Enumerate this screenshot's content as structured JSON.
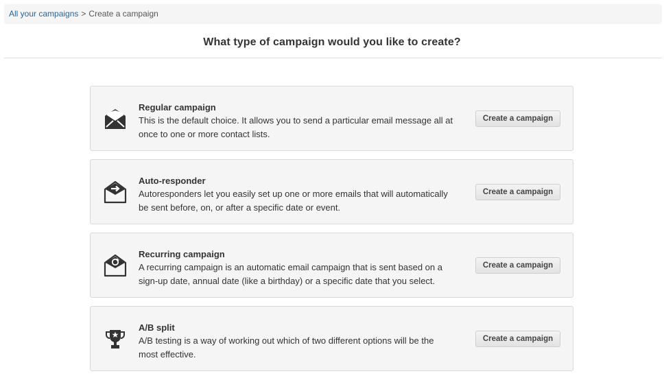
{
  "breadcrumb": {
    "root": "All your campaigns",
    "separator": ">",
    "current": "Create a campaign"
  },
  "title": "What type of campaign would you like to create?",
  "campaigns": [
    {
      "name": "Regular campaign",
      "description": "This is the default choice. It allows you to send a particular email message all at once to one or more contact lists.",
      "button": "Create a campaign",
      "icon": "open-envelope-icon"
    },
    {
      "name": "Auto-responder",
      "description": "Autoresponders let you easily set up one or more emails that will automatically be sent before, on, or after a specific date or event.",
      "button": "Create a campaign",
      "icon": "envelope-arrow-icon"
    },
    {
      "name": "Recurring campaign",
      "description": "A recurring campaign is an automatic email campaign that is sent based on a sign-up date, annual date (like a birthday) or a specific date that you select.",
      "button": "Create a campaign",
      "icon": "envelope-recurring-icon"
    },
    {
      "name": "A/B split",
      "description": "A/B testing is a way of working out which of two different options will be the most effective.",
      "button": "Create a campaign",
      "icon": "trophy-star-icon"
    }
  ]
}
